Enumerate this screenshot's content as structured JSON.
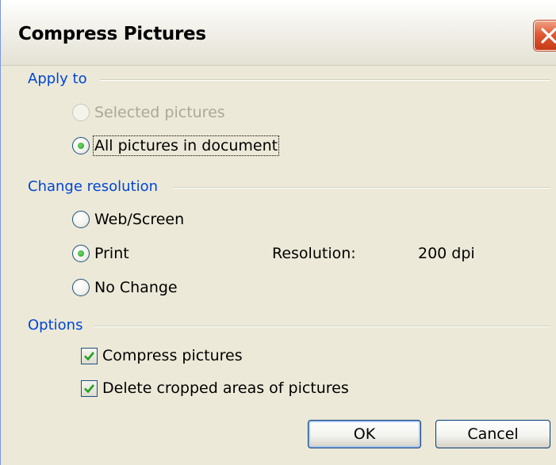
{
  "dialog": {
    "title": "Compress Pictures"
  },
  "sections": {
    "apply_to": {
      "label": "Apply to",
      "options": [
        {
          "label": "Selected pictures",
          "selected": false,
          "enabled": false
        },
        {
          "label": "All pictures in document",
          "selected": true,
          "enabled": true
        }
      ]
    },
    "change_resolution": {
      "label": "Change resolution",
      "options": [
        {
          "label": "Web/Screen",
          "selected": false
        },
        {
          "label": "Print",
          "selected": true
        },
        {
          "label": "No Change",
          "selected": false
        }
      ],
      "resolution_label": "Resolution:",
      "resolution_value": "200 dpi"
    },
    "options": {
      "label": "Options",
      "checkboxes": [
        {
          "label": "Compress pictures",
          "checked": true
        },
        {
          "label": "Delete cropped areas of pictures",
          "checked": true
        }
      ]
    }
  },
  "buttons": {
    "ok": "OK",
    "cancel": "Cancel"
  },
  "colors": {
    "section_label": "#0046d5",
    "dialog_bg": "#ece9d8",
    "close_button": "#e05a35"
  },
  "icons": {
    "close": "close-x-icon",
    "check": "checkmark-icon",
    "radio": "radio-dot-icon"
  }
}
